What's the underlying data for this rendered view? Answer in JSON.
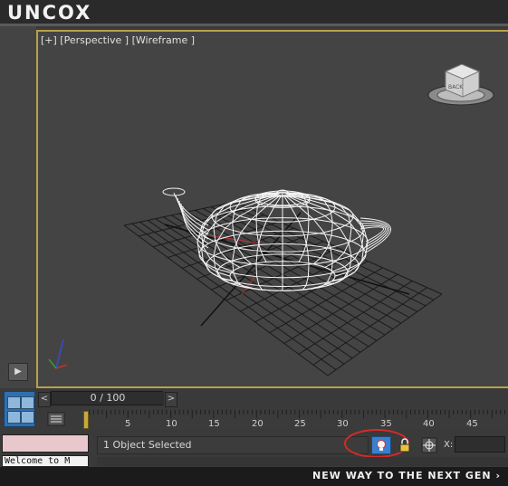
{
  "brand": {
    "logo_text": "UNCOX",
    "tagline": "NEW WAY TO THE NEXT GEN ›"
  },
  "viewport": {
    "label": "[+] [Perspective ] [Wireframe ]",
    "viewcube_face": "BACK"
  },
  "timeline": {
    "frame_display": "0 / 100",
    "prev_label": "<",
    "next_label": ">",
    "ticks": [
      "5",
      "10",
      "15",
      "20",
      "25",
      "30",
      "35",
      "40",
      "45"
    ]
  },
  "status": {
    "selection_text": "1 Object Selected",
    "listener_text": "Welcome to M",
    "x_label": "X:",
    "x_value": ""
  },
  "controls": {
    "play_label": "▶"
  },
  "colors": {
    "viewport_bg": "#444444",
    "active_border": "#b8a24a",
    "accent_blue": "#3c7fcf",
    "highlight_red": "#d42a2a"
  }
}
